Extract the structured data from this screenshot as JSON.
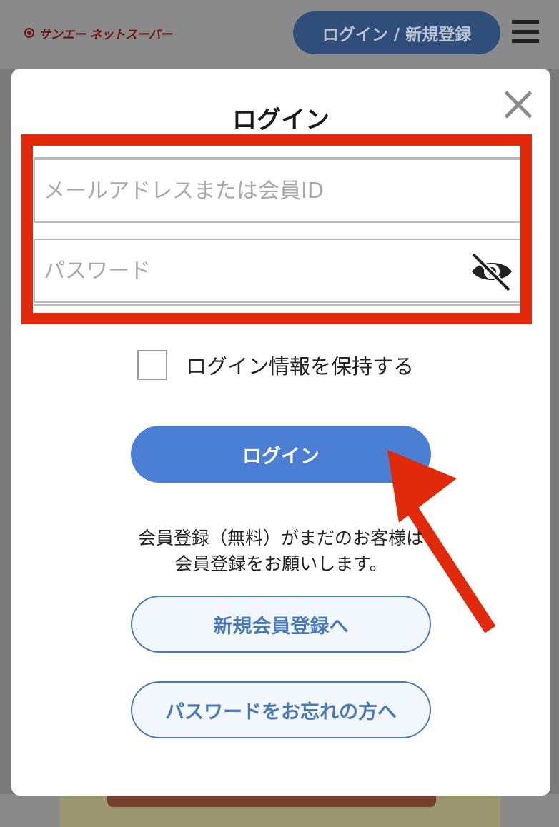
{
  "header": {
    "logo_text": "サンエー ネットスーパー",
    "login_register_button": "ログイン / 新規登録",
    "menu_icon": "hamburger-menu-icon"
  },
  "modal": {
    "title": "ログイン",
    "close_icon": "close-icon",
    "email_placeholder": "メールアドレスまたは会員ID",
    "email_value": "",
    "password_placeholder": "パスワード",
    "password_value": "",
    "password_visibility_icon": "eye-slash-icon",
    "remember_label": "ログイン情報を保持する",
    "remember_checked": false,
    "login_button": "ログイン",
    "note_line1": "会員登録（無料）がまだのお客様は",
    "note_line2": "会員登録をお願いします。",
    "register_button": "新規会員登録へ",
    "forgot_password_button": "パスワードをお忘れの方へ"
  },
  "annotations": {
    "highlight_color": "#e12a0b",
    "arrow_color": "#e12a0b"
  },
  "colors": {
    "primary_button": "#4a7fd4",
    "outline_button_text": "#4a78b8",
    "overlay": "#7a7a7a"
  }
}
